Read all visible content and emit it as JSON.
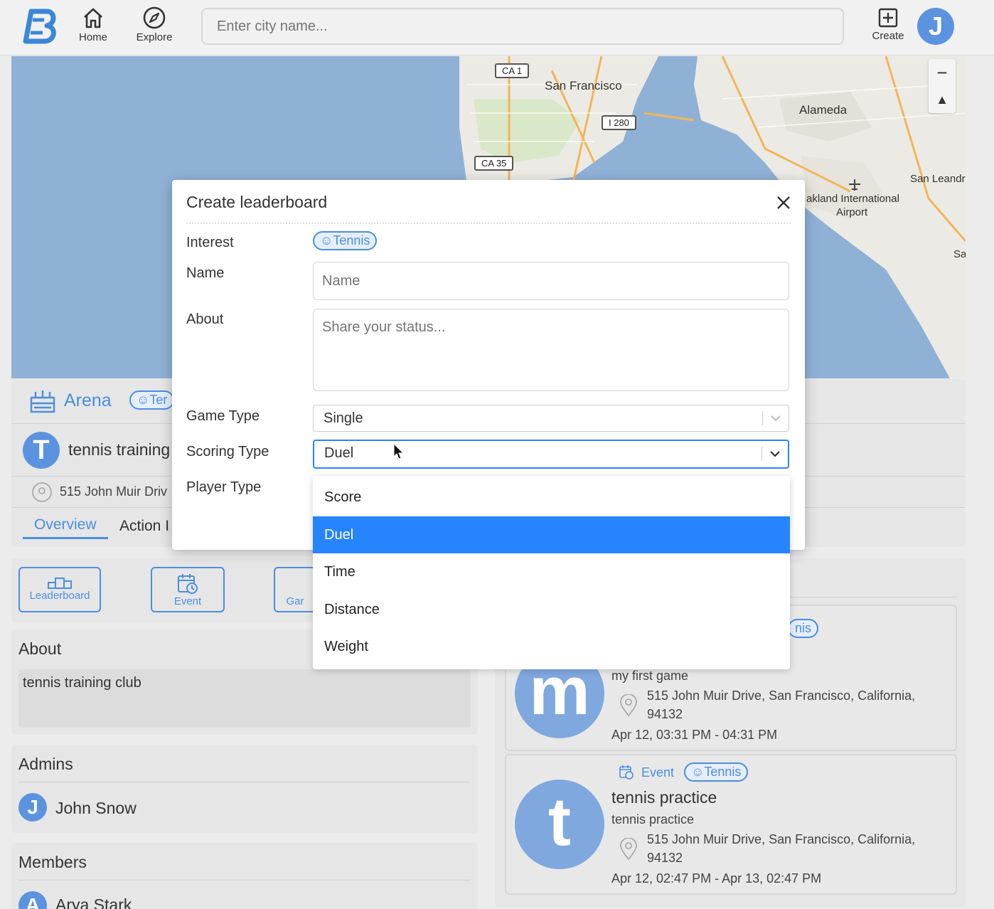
{
  "topbar": {
    "home_label": "Home",
    "explore_label": "Explore",
    "search_placeholder": "Enter city name...",
    "create_label": "Create",
    "user_initial": "J"
  },
  "map": {
    "labels": [
      "San Francisco",
      "Alameda",
      "San Leandr",
      "akland International",
      "Airport",
      "Sa"
    ],
    "road_signs": [
      "CA 1",
      "I 280",
      "CA 35"
    ]
  },
  "arena": {
    "title": "Arena",
    "tag": "Ter",
    "club_initial": "T",
    "club_name": "tennis training",
    "address": "515 John Muir Driv",
    "tabs": [
      "Overview",
      "Action I"
    ]
  },
  "quick_actions": [
    "Leaderboard",
    "Event",
    "Gar"
  ],
  "about": {
    "title": "About",
    "text": "tennis training club"
  },
  "admins": {
    "title": "Admins",
    "items": [
      {
        "initial": "J",
        "name": "John Snow"
      }
    ]
  },
  "members": {
    "title": "Members",
    "items": [
      {
        "initial": "A",
        "name": "Arya Stark"
      }
    ]
  },
  "cards": [
    {
      "tag": "nis",
      "initial": "m",
      "subtitle": "my first game",
      "address_line1": "515 John Muir Drive, San Francisco, California,",
      "address_line2": "94132",
      "time": "Apr 12, 03:31 PM - 04:31 PM"
    },
    {
      "type_label": "Event",
      "tag": "Tennis",
      "initial": "t",
      "title": "tennis practice",
      "subtitle": "tennis practice",
      "address_line1": "515 John Muir Drive, San Francisco, California,",
      "address_line2": "94132",
      "time": "Apr 12, 02:47 PM - Apr 13, 02:47 PM"
    }
  ],
  "modal": {
    "title": "Create leaderboard",
    "interest_label": "Interest",
    "interest_tag": "Tennis",
    "name_label": "Name",
    "name_placeholder": "Name",
    "about_label": "About",
    "about_placeholder": "Share your status...",
    "game_type_label": "Game Type",
    "game_type_value": "Single",
    "scoring_type_label": "Scoring Type",
    "scoring_type_value": "Duel",
    "player_type_label": "Player Type",
    "scoring_options": [
      "Score",
      "Duel",
      "Time",
      "Distance",
      "Weight"
    ],
    "selected_option": "Duel"
  },
  "colors": {
    "accent": "#4b8ee0",
    "select_blue": "#2684ff",
    "avatar": "#5b93e0"
  }
}
